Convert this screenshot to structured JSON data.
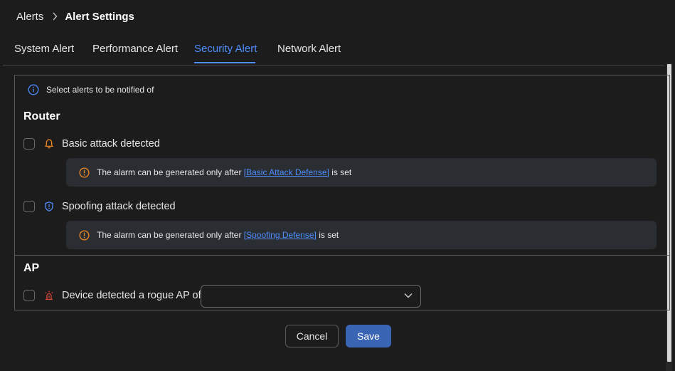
{
  "breadcrumb": {
    "root": "Alerts",
    "current": "Alert Settings"
  },
  "tabs": [
    {
      "label": "System Alert",
      "active": false
    },
    {
      "label": "Performance Alert",
      "active": false
    },
    {
      "label": "Security Alert",
      "active": true
    },
    {
      "label": "Network Alert",
      "active": false
    }
  ],
  "info": {
    "text": "Select alerts to be notified of"
  },
  "router": {
    "title": "Router",
    "items": [
      {
        "label": "Basic attack detected",
        "icon": "bell-icon",
        "checked": false,
        "note": {
          "prefix": "The alarm can be generated only after ",
          "link": "[Basic Attack Defense]",
          "suffix": " is set"
        }
      },
      {
        "label": "Spoofing attack detected",
        "icon": "shield-icon",
        "checked": false,
        "note": {
          "prefix": "The alarm can be generated only after ",
          "link": "[Spoofing Defense]",
          "suffix": " is set"
        }
      }
    ]
  },
  "ap": {
    "title": "AP",
    "items": [
      {
        "label": "Device detected a rogue AP of",
        "icon": "alarm-siren-icon",
        "checked": false,
        "select_value": ""
      }
    ]
  },
  "buttons": {
    "cancel": "Cancel",
    "save": "Save"
  },
  "colors": {
    "accent": "#4d8dff",
    "warning": "#f08a24",
    "danger": "#e0453a",
    "primary_button": "#3a64b4",
    "background": "#1c1c1c"
  }
}
